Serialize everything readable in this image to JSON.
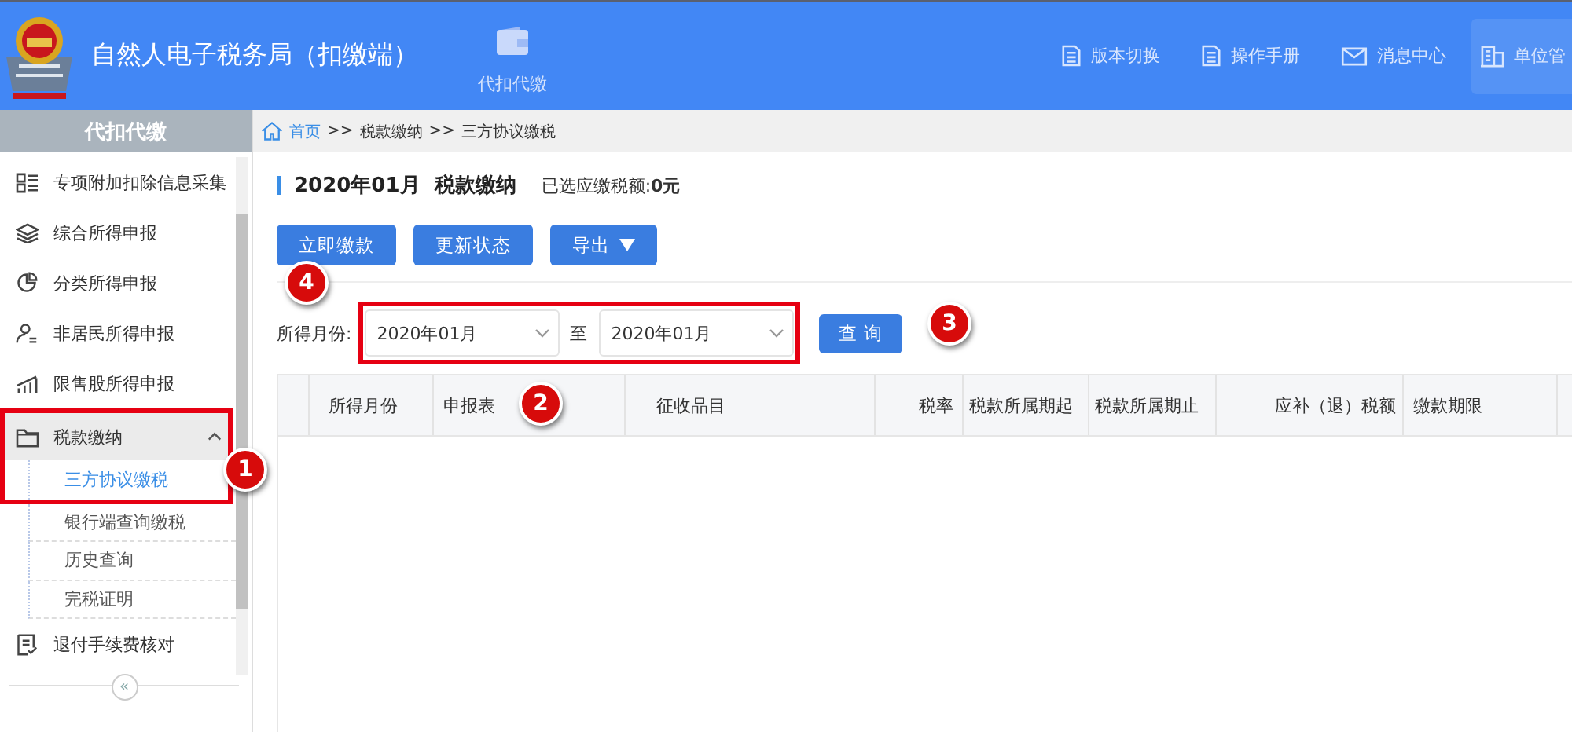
{
  "header": {
    "title": "自然人电子税务局（扣缴端）",
    "center_nav": {
      "label": "代扣代缴"
    },
    "nav": [
      {
        "label": "版本切换",
        "selected": false
      },
      {
        "label": "操作手册",
        "selected": false
      },
      {
        "label": "消息中心",
        "selected": false
      },
      {
        "label": "单位管",
        "selected": true
      }
    ]
  },
  "sidebar": {
    "title": "代扣代缴",
    "items": [
      {
        "label": "专项附加扣除信息采集"
      },
      {
        "label": "综合所得申报"
      },
      {
        "label": "分类所得申报"
      },
      {
        "label": "非居民所得申报"
      },
      {
        "label": "限售股所得申报"
      },
      {
        "label": "税款缴纳",
        "expanded": true,
        "children": [
          {
            "label": "三方协议缴税",
            "selected": true
          },
          {
            "label": "银行端查询缴税",
            "selected": false
          },
          {
            "label": "历史查询",
            "selected": false
          },
          {
            "label": "完税证明",
            "selected": false
          }
        ]
      },
      {
        "label": "退付手续费核对"
      }
    ],
    "collapse": "«"
  },
  "breadcrumb": [
    "首页",
    ">>",
    "税款缴纳",
    ">>",
    "三方协议缴税"
  ],
  "page": {
    "title": "2020年01月  税款缴纳",
    "summary_label": "已选应缴税额:",
    "summary_value": "0元",
    "buttons": [
      {
        "label": "立即缴款",
        "kind": "button"
      },
      {
        "label": "更新状态",
        "kind": "button"
      },
      {
        "label": "导出",
        "kind": "dropdown"
      }
    ],
    "filter": {
      "label": "所得月份:",
      "from": "2020年01月",
      "separator": "至",
      "to": "2020年01月",
      "query": "查 询"
    }
  },
  "table": {
    "columns": [
      "所得月份",
      "申报表",
      "征收品目",
      "税率",
      "税款所属期起",
      "税款所属期止",
      "应补（退）税额",
      "缴款期限"
    ]
  },
  "annotations": [
    {
      "label": "1"
    },
    {
      "label": "2"
    },
    {
      "label": "3"
    },
    {
      "label": "4"
    }
  ]
}
